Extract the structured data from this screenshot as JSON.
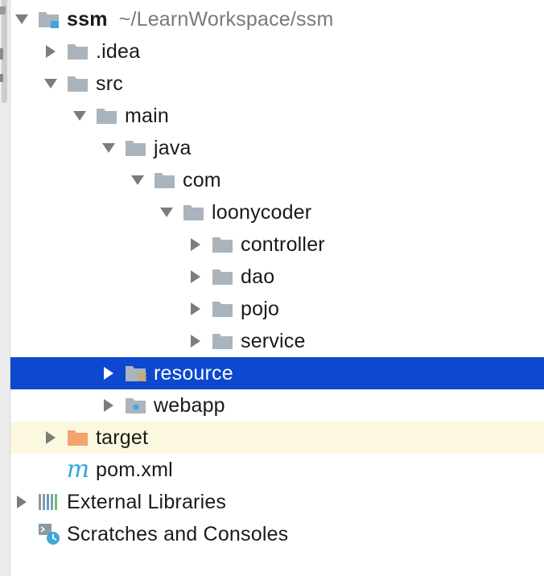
{
  "project": {
    "name": "ssm",
    "path": "~/LearnWorkspace/ssm"
  },
  "tree": [
    {
      "label": "ssm",
      "depth": 0,
      "arrow": "down",
      "icon": "module-folder-icon"
    },
    {
      "label": ".idea",
      "depth": 1,
      "arrow": "right",
      "icon": "folder-icon"
    },
    {
      "label": "src",
      "depth": 1,
      "arrow": "down",
      "icon": "folder-icon"
    },
    {
      "label": "main",
      "depth": 2,
      "arrow": "down",
      "icon": "folder-icon"
    },
    {
      "label": "java",
      "depth": 3,
      "arrow": "down",
      "icon": "folder-icon"
    },
    {
      "label": "com",
      "depth": 4,
      "arrow": "down",
      "icon": "folder-icon"
    },
    {
      "label": "loonycoder",
      "depth": 5,
      "arrow": "down",
      "icon": "folder-icon"
    },
    {
      "label": "controller",
      "depth": 6,
      "arrow": "right",
      "icon": "folder-icon"
    },
    {
      "label": "dao",
      "depth": 6,
      "arrow": "right",
      "icon": "folder-icon"
    },
    {
      "label": "pojo",
      "depth": 6,
      "arrow": "right",
      "icon": "folder-icon"
    },
    {
      "label": "service",
      "depth": 6,
      "arrow": "right",
      "icon": "folder-icon"
    },
    {
      "label": "resource",
      "depth": 3,
      "arrow": "right",
      "icon": "resources-folder-icon",
      "selected": true
    },
    {
      "label": "webapp",
      "depth": 3,
      "arrow": "right",
      "icon": "web-folder-icon"
    },
    {
      "label": "target",
      "depth": 1,
      "arrow": "right",
      "icon": "excluded-folder-icon",
      "excluded": true
    },
    {
      "label": "pom.xml",
      "depth": 1,
      "arrow": "none",
      "icon": "maven-file-icon"
    },
    {
      "label": "External Libraries",
      "depth": 0,
      "arrow": "right",
      "icon": "libraries-icon"
    },
    {
      "label": "Scratches and Consoles",
      "depth": 0,
      "arrow": "none",
      "icon": "scratches-icon"
    }
  ],
  "colors": {
    "selection": "#0c48d0",
    "excluded_row": "#fbf8df",
    "folder": "#a9b4bd",
    "excluded_folder": "#f4a26e",
    "accent": "#35a7d8"
  }
}
